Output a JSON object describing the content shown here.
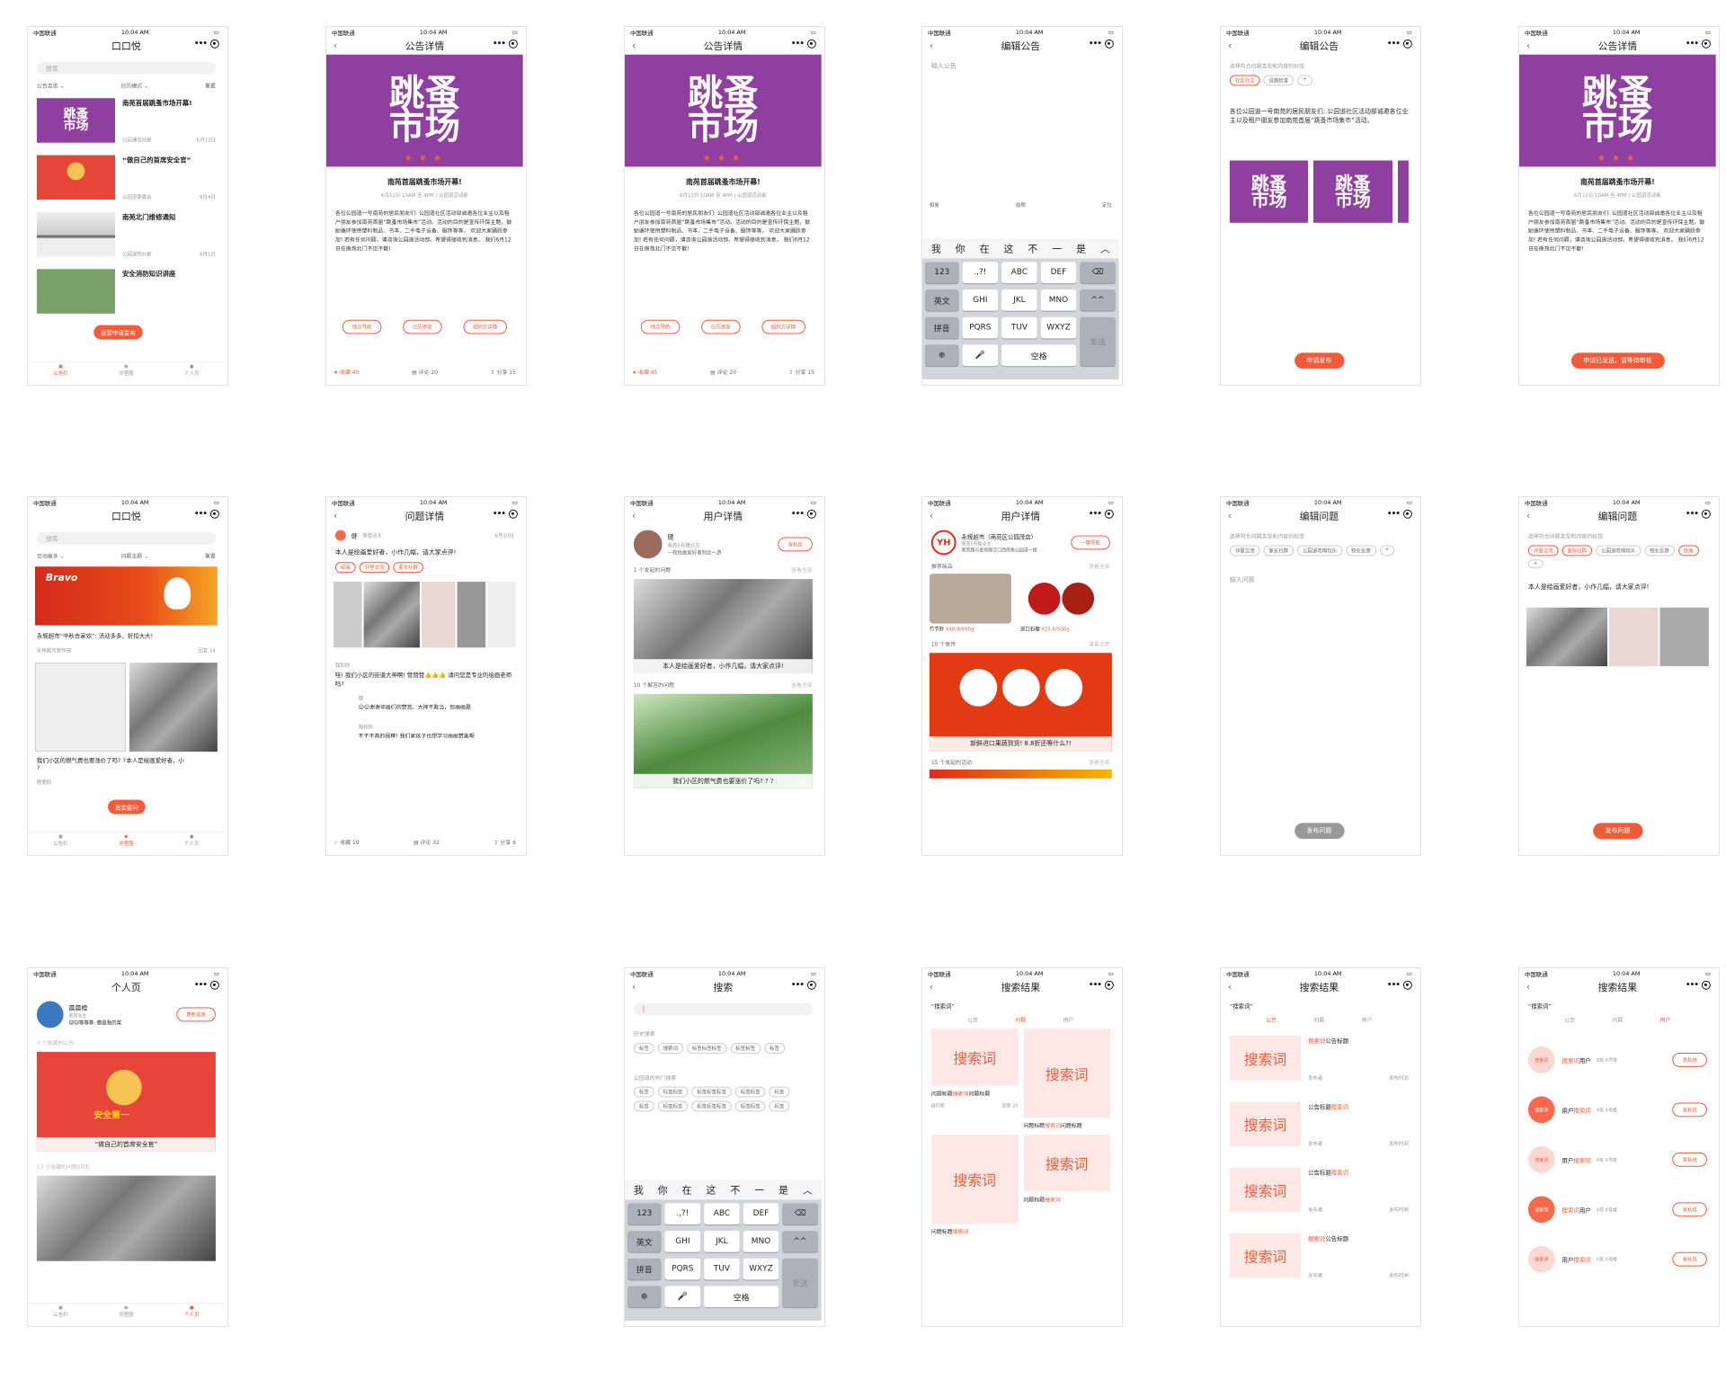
{
  "status": {
    "carrier": "中国联通",
    "time": "10:04 AM"
  },
  "nav": {
    "back": "‹",
    "dots": "•••"
  },
  "p1": {
    "title": "口口悦",
    "search": "搜索",
    "f1": "公告类型 ⌄",
    "f2": "日历模式 ⌄",
    "f3": "重置",
    "items": [
      {
        "title": "南苑首届跳蚤市场开幕!",
        "by": "公园通活动部",
        "date": "6月12日"
      },
      {
        "title": "“做自己的首席安全官”",
        "by": "公园道委委会",
        "date": "6月4日"
      },
      {
        "title": "南苑北门维修通知",
        "by": "公园道物业部",
        "date": "6月1日"
      },
      {
        "title": "安全消防知识讲座",
        "by": "",
        "date": ""
      }
    ],
    "fab": "我要申请发布",
    "tabs": [
      "公告栏",
      "邻里圈",
      "个人页"
    ]
  },
  "article": {
    "nav": "公告详情",
    "logo1": "跳蚤",
    "logo2": "市场",
    "dots": "● ● ●",
    "title": "南苑首届跳蚤市场开幕!",
    "meta": "6月12日 10AM 至 4PM | 公园道活动部",
    "body": "各位公园道一号南苑的居民朋友们: 公园道社区活动部诚邀各位业主以及租户朋友参加南苑首届“跳蚤市场集市”活动。活动的目的是宣传环保主题，鼓励循环使用塑料制品、书本、二手电子设备、服饰等等。 欢迎大家踊跃参加! 若有任何问题，请咨询公园道活动部。希望得接收到消息。 我们6月12日在南苑北门不见不散!",
    "b1": "地点导航",
    "b2": "日历添加",
    "b3": "组织方详情",
    "fav": "★ 收藏 45",
    "com": "▤ 评论 20",
    "share": "⇪ 分享 15"
  },
  "p4": {
    "nav": "编辑公告",
    "ph": "输入公告",
    "t1": "相册",
    "t2": "拍照",
    "t3": "定位"
  },
  "keyboard": {
    "cands": [
      "我",
      "你",
      "在",
      "这",
      "不",
      "一",
      "是",
      "︿"
    ],
    "r1": [
      "123",
      ".,?!",
      "ABC",
      "DEF",
      "⌫"
    ],
    "r2": [
      "英文",
      "GHI",
      "JKL",
      "MNO",
      "^^"
    ],
    "r3": [
      "拼音",
      "PQRS",
      "TUV",
      "WXYZ",
      "发送"
    ],
    "r4": [
      "⊕",
      "🎤",
      "空格"
    ]
  },
  "p5": {
    "nav": "编辑公告",
    "hint": "选择符合问题类型和内容的标签",
    "tags": [
      "社区社交",
      "设施检查",
      "+"
    ],
    "text": "各位公园道一号南苑的居民朋友们: 公园道社区活动部诚邀各位业主以及租户朋友参加南苑首届“跳蚤市场集市”活动。",
    "cta": "申请发布"
  },
  "p6": {
    "cta": "申请已发送，请等待审核"
  },
  "p7": {
    "title": "口口悦",
    "f1": "互动最多 ⌄",
    "f2": "问题主题 ⌄",
    "f3": "重置",
    "brand": "Bravo",
    "c1": "永辉超市“中秋合家欢”: 活动多多，折扣大大!",
    "c1by": "永辉超市宣传部",
    "c1n": "回复 24",
    "c2": "我们小区的燃气费也要涨价了吗? ? ?",
    "c3": "本人是绘画爱好者，小",
    "c2by": "鹿鹿妈",
    "fab": "我要提问"
  },
  "p8": {
    "nav": "问题详情",
    "user": "健",
    "sub": "南苑业主",
    "date": "6月10日",
    "text": "本人是绘画爱好者，小作几幅，请大家点评!",
    "tags": [
      "绘画",
      "邻里交流",
      "家长社群"
    ],
    "cm1u": "我和你",
    "cm1": "哇! 我们小区的街道大神啊! 赞赞赞👍👍👍 请问您是专业的绘画老师吗?",
    "r1u": "健",
    "r1": "😊😊谢谢邻居们的赞赏。大神不敢当，但画画是",
    "r2u": "我和你",
    "r2": "不不不真的很棒! 我们家孩子也想学习画画赞美啊",
    "fav": "☆ 收藏 19",
    "com": "▤ 评论 32",
    "share": "⇪ 分享 6"
  },
  "p9": {
    "nav": "用户详情",
    "user": "健",
    "sub": "南苑5号楼业主",
    "bio": "一枚绘画爱好者到此一游",
    "btn": "发私信",
    "s1": "1 个发起的问题",
    "s2": "10 个解答的问题",
    "all": "查看全部",
    "c1": "本人是绘画爱好者，小作几幅，请大家点评!",
    "c2": "我们小区的燃气费也要涨价了吗? ? ?"
  },
  "p10": {
    "nav": "用户详情",
    "name": "永辉超市（南苑区公园茂店）",
    "sub": "南苑5号楼业主",
    "addr": "南苑路与金荷路交口西南角公园道一楼",
    "btn": "一键导航",
    "s1": "推荐商品",
    "s2": "10 个宣传",
    "s3": "15 个发起的活动",
    "all": "查看全部",
    "g1": "竹节虾",
    "g1p": "¥48.9/500g",
    "g2": "进口石榴",
    "g2p": "¥25.6/500g",
    "promo": "新鲜进口果蔬到货! 8.8折还等什么?!"
  },
  "p11": {
    "nav": "编辑问题",
    "hint": "选择符合问题类型和内容的标签",
    "tags": [
      "邻里交流",
      "家长社群",
      "公园道吃喝玩乐",
      "物业反馈",
      "+"
    ],
    "ph": "输入问题",
    "cta": "发布问题"
  },
  "p12": {
    "nav": "编辑问题",
    "tags": [
      "邻里交流",
      "家长社群",
      "公园道吃喝玩乐",
      "物业反馈",
      "绘画",
      "+"
    ],
    "text": "本人是绘画爱好者，小作几幅，请大家点评!",
    "cta": "发布问题"
  },
  "p13": {
    "title": "个人页",
    "user": "晨晨橙",
    "sub": "南苑业主",
    "bio": "🐱🐱等等等: 都是我的菜",
    "btn": "更新信息",
    "s1": "3 个收藏的公告",
    "c1": "“做自己的首席安全官”",
    "badge": "安全第一",
    "s2": "13 个收藏的问题/回答"
  },
  "p15": {
    "nav": "搜索",
    "hist": "历史搜索",
    "hot": "公园道的热门搜索",
    "tag": "标签",
    "tag2": "标签标签",
    "tag3": "标签标签标签",
    "tag4": "搜索词"
  },
  "search": {
    "nav": "搜索结果",
    "kw": "“搜索词”",
    "tabs": [
      "公告",
      "问题",
      "用户"
    ],
    "word": "搜索词",
    "q1": "问题标题",
    "q2": "问题标题",
    "qby": "提问者",
    "rep": "回复 20",
    "n1": "公告标题",
    "npub": "发布者",
    "ntime": "发布时间",
    "user": "用户",
    "meta": "X栋 X号楼",
    "btn": "发私信"
  }
}
